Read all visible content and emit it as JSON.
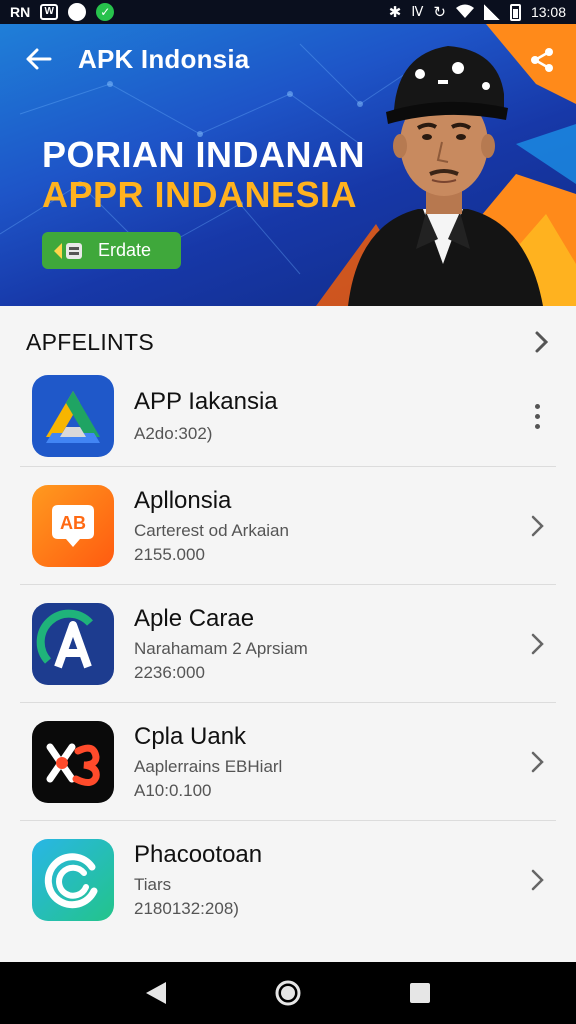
{
  "status_bar": {
    "left_text": "RN",
    "box_icon_letter": "W",
    "time": "13:08"
  },
  "app_bar": {
    "title": "APK Indonsia"
  },
  "banner": {
    "headline_line1": "PORIAN INDANAN",
    "headline_line2": "APPR INDANESIA",
    "button_label": "Erdate",
    "colors": {
      "headline2": "#ffb21f",
      "button": "#3fa83b",
      "accent_orange": "#ff8a1a"
    }
  },
  "section": {
    "title": "APFELINTS"
  },
  "apps": [
    {
      "name": "APP Iakansia",
      "sub": "",
      "num": "A2do:302)",
      "icon": "drive-triangle-icon",
      "action": "more"
    },
    {
      "name": "Apllonsia",
      "sub": "Carterest od Arkaian",
      "num": "2155.000",
      "icon": "ab-badge-icon",
      "action": "chevron"
    },
    {
      "name": "Aple Carae",
      "sub": "Narahamam 2 Aprsiam",
      "num": "2236:000",
      "icon": "letter-a-icon",
      "action": "chevron"
    },
    {
      "name": "Cpla Uank",
      "sub": "Aaplerrains EBHiarl",
      "num": "A10:0.100",
      "icon": "xs-logo-icon",
      "action": "chevron"
    },
    {
      "name": "Phacootoan",
      "sub": "Tiars",
      "num": "2180132:208)",
      "icon": "c-swirl-icon",
      "action": "chevron"
    }
  ]
}
